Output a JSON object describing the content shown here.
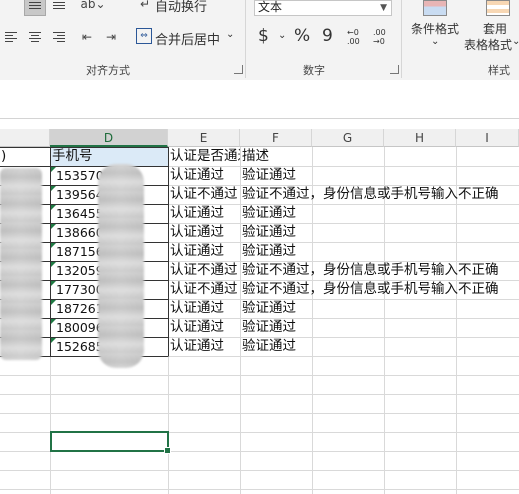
{
  "ribbon": {
    "wrap_text_label": "自动换行",
    "merge_center_label": "合并后居中",
    "alignment_group_label": "对齐方式",
    "number_group_label": "数字",
    "style_group_label": "样式",
    "number_format_value": "文本",
    "currency_symbol": "$",
    "percent_symbol": "%",
    "comma_symbol": "9",
    "increase_decimal_label": "←0 .00",
    "decrease_decimal_label": ".00 →0",
    "conditional_format_label": "条件格式",
    "table_format_label_line1": "套用",
    "table_format_label_line2": "表格格式"
  },
  "grid": {
    "columns": [
      "D",
      "E",
      "F",
      "G",
      "H",
      "I"
    ],
    "partial_col_c_header_text": ")",
    "header_row": {
      "d": "手机号",
      "e": "认证是否通过",
      "f": "描述"
    },
    "rows": [
      {
        "d": "1535703",
        "e": "认证通过",
        "f": "验证通过"
      },
      {
        "d": "1395647",
        "e": "认证不通过",
        "f": "验证不通过，身份信息或手机号输入不正确"
      },
      {
        "d": "1364551",
        "e": "认证通过",
        "f": "验证通过"
      },
      {
        "d": "1386604",
        "e": "认证通过",
        "f": "验证通过"
      },
      {
        "d": "1871564",
        "e": "认证通过",
        "f": "验证通过"
      },
      {
        "d": "1320595",
        "e": "认证不通过",
        "f": "验证不通过，身份信息或手机号输入不正确"
      },
      {
        "d": "1773006",
        "e": "认证不通过",
        "f": "验证不通过，身份信息或手机号输入不正确"
      },
      {
        "d": "1872617",
        "e": "认证通过",
        "f": "验证通过"
      },
      {
        "d": "1800961",
        "e": "认证通过",
        "f": "验证通过"
      },
      {
        "d": "1526854",
        "e": "认证通过",
        "f": "验证通过"
      }
    ]
  },
  "colors": {
    "accent_green": "#217346",
    "selected_header_bg": "#d2d2d2",
    "header_bg": "#f0f0f0",
    "gridline": "#d9d9d9"
  }
}
